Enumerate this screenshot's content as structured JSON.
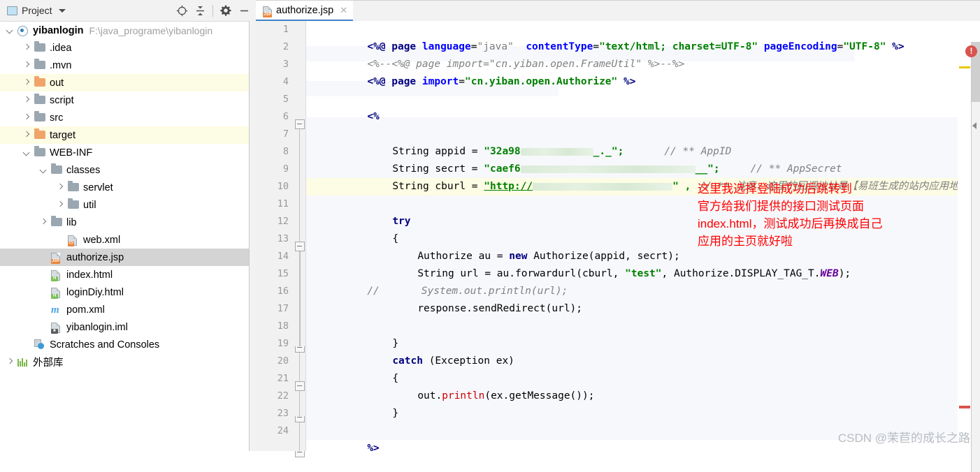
{
  "sidebar": {
    "toolbar": {
      "title": "Project",
      "dropdown_icon": "chevron-down-icon",
      "locate_icon": "target-locate-icon",
      "collapse_icon": "collapse-all-icon",
      "settings_icon": "gear-icon",
      "minimize_icon": "minimize-icon"
    },
    "project": {
      "name": "yibanlogin",
      "path": "F:\\java_programe\\yibanlogin"
    },
    "items": [
      {
        "label": ".idea",
        "icon": "folder-icon",
        "indent": 1,
        "state": "collapsed",
        "highlight": "none"
      },
      {
        "label": ".mvn",
        "icon": "folder-icon",
        "indent": 1,
        "state": "collapsed",
        "highlight": "none"
      },
      {
        "label": "out",
        "icon": "folder-orange-icon",
        "indent": 1,
        "state": "collapsed",
        "highlight": "yellow"
      },
      {
        "label": "script",
        "icon": "folder-icon",
        "indent": 1,
        "state": "collapsed",
        "highlight": "none"
      },
      {
        "label": "src",
        "icon": "folder-icon",
        "indent": 1,
        "state": "collapsed",
        "highlight": "none"
      },
      {
        "label": "target",
        "icon": "folder-orange-icon",
        "indent": 1,
        "state": "collapsed",
        "highlight": "yellow"
      },
      {
        "label": "WEB-INF",
        "icon": "folder-icon",
        "indent": 1,
        "state": "expanded",
        "highlight": "none"
      },
      {
        "label": "classes",
        "icon": "folder-icon",
        "indent": 2,
        "state": "expanded",
        "highlight": "none"
      },
      {
        "label": "servlet",
        "icon": "folder-icon",
        "indent": 3,
        "state": "collapsed",
        "highlight": "none"
      },
      {
        "label": "util",
        "icon": "folder-icon",
        "indent": 3,
        "state": "collapsed",
        "highlight": "none"
      },
      {
        "label": "lib",
        "icon": "folder-icon",
        "indent": 2,
        "state": "collapsed",
        "highlight": "none"
      },
      {
        "label": "web.xml",
        "icon": "xml-file-icon",
        "indent": 3,
        "state": "leaf",
        "highlight": "none"
      },
      {
        "label": "authorize.jsp",
        "icon": "jsp-file-icon",
        "indent": 2,
        "state": "leaf",
        "highlight": "selected"
      },
      {
        "label": "index.html",
        "icon": "html-file-icon",
        "indent": 2,
        "state": "leaf",
        "highlight": "none"
      },
      {
        "label": "loginDiy.html",
        "icon": "html-file-icon",
        "indent": 2,
        "state": "leaf",
        "highlight": "none"
      },
      {
        "label": "pom.xml",
        "icon": "maven-file-icon",
        "indent": 2,
        "state": "leaf",
        "highlight": "none"
      },
      {
        "label": "yibanlogin.iml",
        "icon": "iml-file-icon",
        "indent": 2,
        "state": "leaf",
        "highlight": "none"
      },
      {
        "label": "Scratches and Consoles",
        "icon": "scratches-icon",
        "indent": 1,
        "state": "leaf",
        "highlight": "none"
      },
      {
        "label": "外部库",
        "icon": "external-libraries-icon",
        "indent": 0,
        "state": "collapsed",
        "highlight": "none"
      }
    ]
  },
  "editor": {
    "tab": {
      "label": "authorize.jsp",
      "icon": "jsp-file-icon",
      "close_icon": "close-icon",
      "active": true
    },
    "current_line": 10,
    "line_numbers": [
      1,
      2,
      3,
      4,
      5,
      6,
      7,
      8,
      9,
      10,
      11,
      12,
      13,
      14,
      15,
      16,
      17,
      18,
      19,
      20,
      21,
      22,
      23,
      24
    ],
    "lines": [
      {
        "n": 1,
        "text": "<%@ page language=\"java\" contentType=\"text/html; charset=UTF-8\" pageEncoding=\"UTF-8\" %>"
      },
      {
        "n": 2,
        "text": "<%--<%@ page import=\"cn.yiban.open.FrameUtil\" %>--%>"
      },
      {
        "n": 3,
        "text": "<%@ page import=\"cn.yiban.open.Authorize\" %>"
      },
      {
        "n": 4,
        "text": ""
      },
      {
        "n": 5,
        "text": "<%"
      },
      {
        "n": 6,
        "text": ""
      },
      {
        "n": 7,
        "text": "    String appid = \"32a98[REDACTED]_._\";      // ** AppID"
      },
      {
        "n": 8,
        "text": "    String secrt = \"caef6[REDACTED]__\";        // ** AppSecret"
      },
      {
        "n": 9,
        "text": "    String cburl = \"http://[REDACTED]\" ,  // ** 注意，这里的回调地址是【易班生成的站内应用地址】"
      },
      {
        "n": 10,
        "text": ""
      },
      {
        "n": 11,
        "text": "    try"
      },
      {
        "n": 12,
        "text": "    {"
      },
      {
        "n": 13,
        "text": "        Authorize au = new Authorize(appid, secrt);"
      },
      {
        "n": 14,
        "text": "        String url = au.forwardurl(cburl, \"test\", Authorize.DISPLAY_TAG_T.WEB);"
      },
      {
        "n": 15,
        "text": "//        System.out.println(url);"
      },
      {
        "n": 16,
        "text": "        response.sendRedirect(url);"
      },
      {
        "n": 17,
        "text": ""
      },
      {
        "n": 18,
        "text": "    }"
      },
      {
        "n": 19,
        "text": "    catch (Exception ex)"
      },
      {
        "n": 20,
        "text": "    {"
      },
      {
        "n": 21,
        "text": "        out.println(ex.getMessage());"
      },
      {
        "n": 22,
        "text": "    }"
      },
      {
        "n": 23,
        "text": ""
      },
      {
        "n": 24,
        "text": "%>"
      }
    ],
    "code_tokens": {
      "l1": {
        "a": "<%@ ",
        "b": "page ",
        "c": "language",
        "d": "=",
        "e": "\"java\"",
        "f": "  ",
        "g": "contentType",
        "h": "=",
        "i": "\"text/html; charset=UTF-8\"",
        "j": " ",
        "k": "pageEncoding",
        "l": "=",
        "m": "\"UTF-8\"",
        "n": " %>"
      },
      "l2": {
        "a": "<%--<%@ page import=\"cn.yiban.open.FrameUtil\" %>--%>"
      },
      "l3": {
        "a": "<%@ ",
        "b": "page ",
        "c": "import",
        "d": "=",
        "e": "\"cn.yiban.open.Authorize\"",
        "f": " %>"
      },
      "l5": {
        "a": "<%"
      },
      "l7": {
        "a": "String appid = ",
        "b": "\"32a98",
        "c": "_._\";",
        "d": "// ** AppID"
      },
      "l8": {
        "a": "String secrt = ",
        "b": "\"caef6",
        "c": "__\";",
        "d": "// ** AppSecret"
      },
      "l9": {
        "a": "String cburl = ",
        "b": "\"http://",
        "c": "\" ,",
        "d": "// ** 注意，这里的回调地址是【易班生成的站内应用地址】"
      },
      "l11": {
        "a": "try"
      },
      "l12": {
        "a": "{"
      },
      "l13": {
        "a": "Authorize au = ",
        "b": "new",
        "c": " Authorize(appid, secrt);"
      },
      "l14": {
        "a": "String url = au.forwardurl(cburl, ",
        "b": "\"test\"",
        "c": ", Authorize.DISPLAY_TAG_T.",
        "d": "WEB",
        "e": ");"
      },
      "l15": {
        "a": "//",
        "b": "System.out.println(url);"
      },
      "l16": {
        "a": "response.sendRedirect(url);"
      },
      "l18": {
        "a": "}"
      },
      "l19": {
        "a": "catch",
        "b": " (Exception ex)"
      },
      "l20": {
        "a": "{"
      },
      "l21": {
        "a": "out.",
        "b": "println",
        "c": "(ex.getMessage());"
      },
      "l22": {
        "a": "}"
      },
      "l24": {
        "a": "%>"
      }
    },
    "annotation": {
      "color": "#ff0000",
      "lines": [
        "这里我选择登陆成功后跳转到",
        "官方给我们提供的接口测试页面",
        "index.html，测试成功后再换成自己",
        "应用的主页就好啦"
      ]
    },
    "markers": {
      "error_badge": "!",
      "error_badge_color": "#d9534f",
      "warning_marker_color": "#e8c600",
      "error_marker_color": "#d9534f"
    }
  },
  "watermark": "CSDN @茉苣的成长之路",
  "colors": {
    "keyword": "#000080",
    "attribute": "#0000ff",
    "string": "#008000",
    "comment": "#808080",
    "function": "#cc0000",
    "static_field": "#660099",
    "current_line_bg": "#fdfce4",
    "jsp_block_bg": "#f7f8fc",
    "selection_bg": "#d4d4d4",
    "tab_accent": "#4083c9"
  }
}
